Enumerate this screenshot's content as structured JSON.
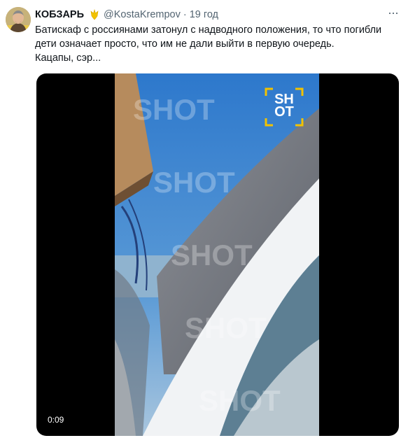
{
  "tweet": {
    "author_name": "КОБЗАРЬ",
    "handle": "@KostaKrempov",
    "separator": "·",
    "time": "19 год",
    "more_label": "···",
    "text_line1": "Батискаф с россиянами затонул с надводного положения, то что погибли",
    "text_line2": "дети означает просто, что им не дали выйти в первую очередь.",
    "text_line3": "Кацапы, сэр...",
    "badge_icon": "trident-icon",
    "badge_color": "#f2c200"
  },
  "video": {
    "duration": "0:09",
    "logo_line1": "SH",
    "logo_line2": "OT",
    "watermark": "SHOT",
    "sky_color": "#2f7fd0",
    "hull_color": "#f1f3f5"
  }
}
